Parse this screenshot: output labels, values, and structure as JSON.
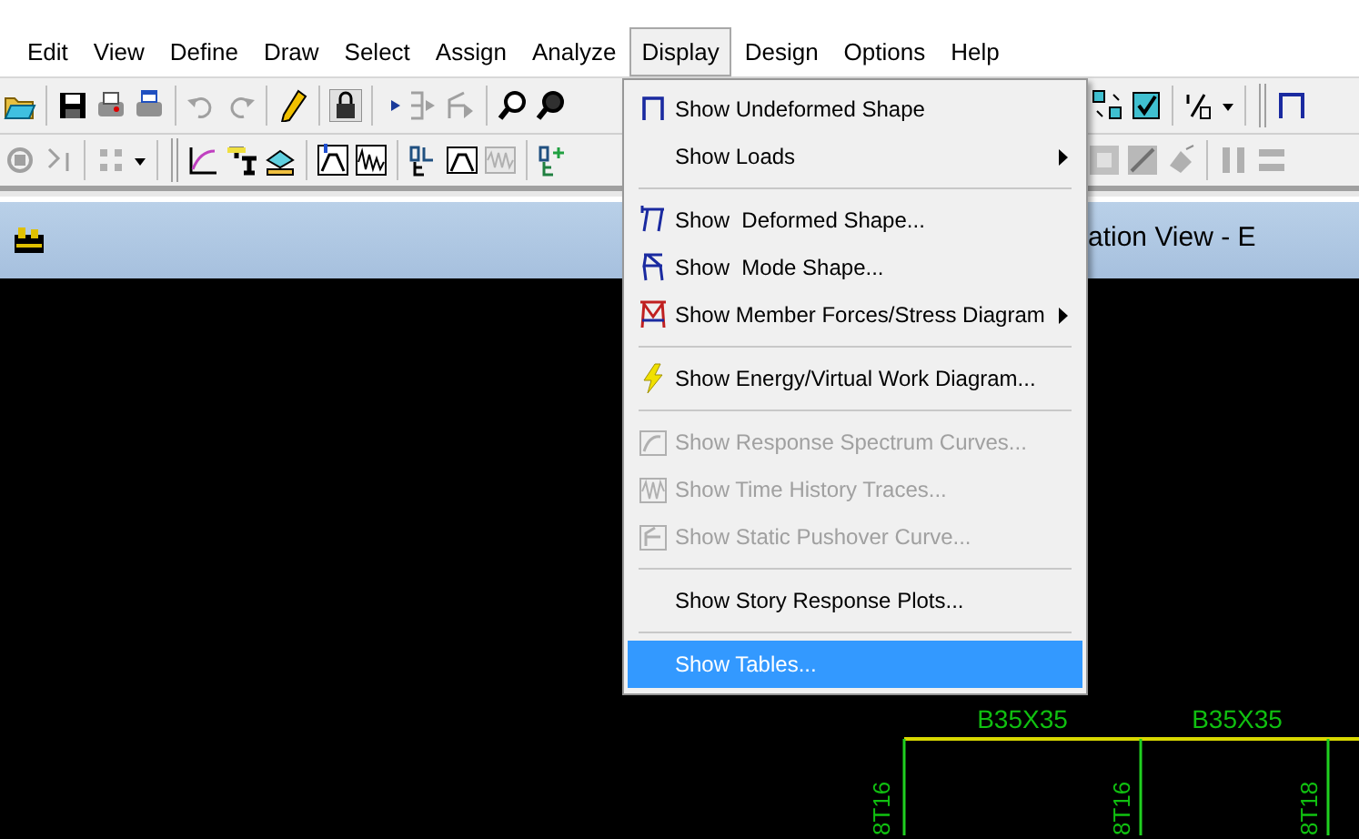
{
  "menubar": [
    {
      "label": "Edit",
      "selected": false
    },
    {
      "label": "View",
      "selected": false
    },
    {
      "label": "Define",
      "selected": false
    },
    {
      "label": "Draw",
      "selected": false
    },
    {
      "label": "Select",
      "selected": false
    },
    {
      "label": "Assign",
      "selected": false
    },
    {
      "label": "Analyze",
      "selected": false
    },
    {
      "label": "Display",
      "selected": true
    },
    {
      "label": "Design",
      "selected": false
    },
    {
      "label": "Options",
      "selected": false
    },
    {
      "label": "Help",
      "selected": false
    }
  ],
  "window": {
    "title": "ation View - E"
  },
  "menu": {
    "groups": [
      [
        {
          "label": "Show Undeformed Shape",
          "disabled": false,
          "selected": false,
          "submenu": false
        },
        {
          "label": "Show Loads",
          "disabled": false,
          "selected": false,
          "submenu": true
        }
      ],
      [
        {
          "label": "Show  Deformed Shape...",
          "disabled": false,
          "selected": false,
          "submenu": false
        },
        {
          "label": "Show  Mode Shape...",
          "disabled": false,
          "selected": false,
          "submenu": false
        },
        {
          "label": "Show Member Forces/Stress Diagram",
          "disabled": false,
          "selected": false,
          "submenu": true
        }
      ],
      [
        {
          "label": "Show Energy/Virtual Work Diagram...",
          "disabled": false,
          "selected": false,
          "submenu": false
        }
      ],
      [
        {
          "label": "Show Response Spectrum Curves...",
          "disabled": true,
          "selected": false,
          "submenu": false
        },
        {
          "label": "Show Time History Traces...",
          "disabled": true,
          "selected": false,
          "submenu": false
        },
        {
          "label": "Show Static Pushover Curve...",
          "disabled": true,
          "selected": false,
          "submenu": false
        }
      ],
      [
        {
          "label": "Show Story Response Plots...",
          "disabled": false,
          "selected": false,
          "submenu": false
        }
      ],
      [
        {
          "label": "Show Tables...",
          "disabled": false,
          "selected": true,
          "submenu": false
        }
      ]
    ]
  },
  "drawing": {
    "beam_labels": [
      "B35X35",
      "B35X35"
    ],
    "column_labels": [
      "8T16",
      "8T16",
      "8T18"
    ]
  }
}
